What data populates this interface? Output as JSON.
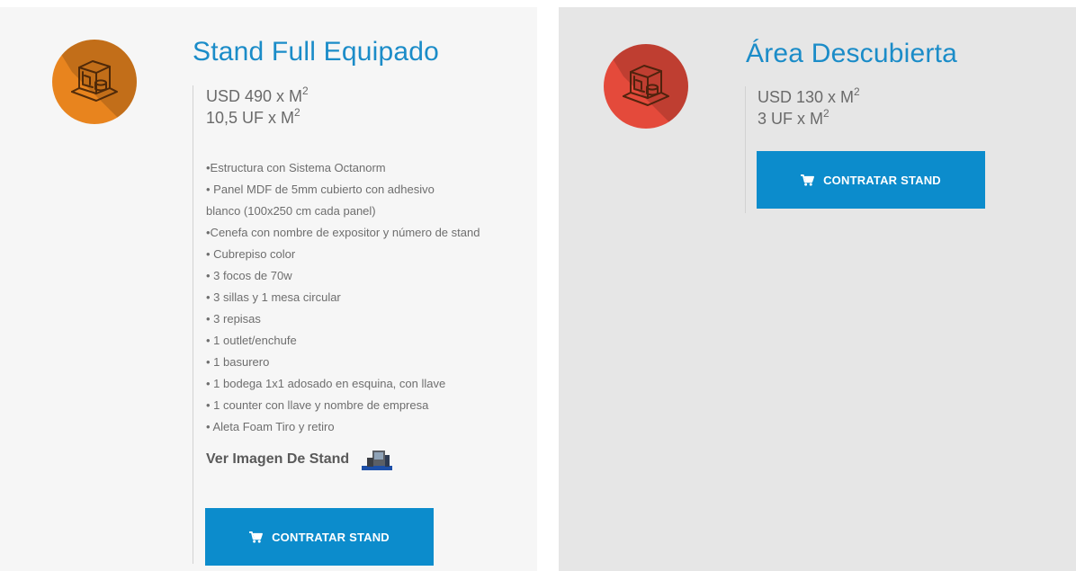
{
  "cards": [
    {
      "title": "Stand Full Equipado",
      "icon": "stand-booth-icon",
      "icon_color": "#e8841e",
      "prices": [
        {
          "text": "USD 490 x M",
          "sup": "2"
        },
        {
          "text": "10,5 UF x M",
          "sup": "2"
        }
      ],
      "features": [
        "•Estructura con Sistema Octanorm",
        "• Panel MDF de 5mm cubierto con adhesivo",
        "blanco (100x250 cm cada panel)",
        "•Cenefa con nombre de expositor y número de stand",
        "• Cubrepiso color",
        "• 3 focos de 70w",
        "• 3 sillas y 1 mesa circular",
        "• 3 repisas",
        "• 1 outlet/enchufe",
        "• 1 basurero",
        "• 1 bodega 1x1 adosado en esquina, con llave",
        "• 1 counter con llave y nombre de empresa",
        "• Aleta Foam Tiro y retiro"
      ],
      "view_image_label": "Ver Imagen De Stand",
      "button_label": "CONTRATAR STAND"
    },
    {
      "title": "Área Descubierta",
      "icon": "stand-booth-icon",
      "icon_color": "#e44a3b",
      "prices": [
        {
          "text": "USD 130 x M",
          "sup": "2"
        },
        {
          "text": "3 UF x M",
          "sup": "2"
        }
      ],
      "button_label": "CONTRATAR STAND"
    }
  ],
  "colors": {
    "title": "#1b8cc8",
    "button": "#0c8ccc",
    "left_card_bg": "#f6f6f6",
    "right_card_bg": "#e6e6e6"
  }
}
